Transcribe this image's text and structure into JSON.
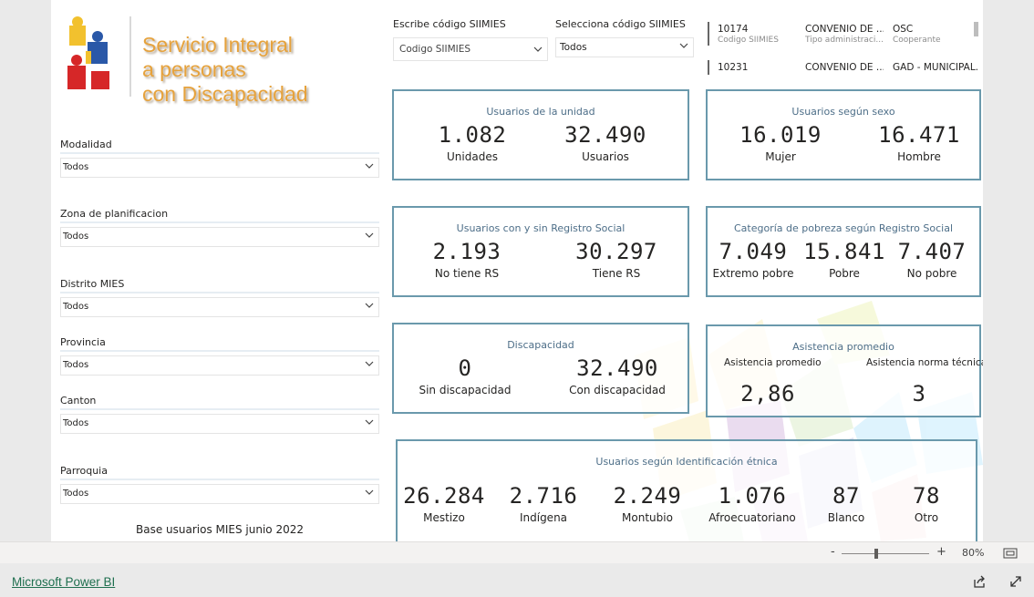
{
  "logo": {
    "lines": [
      "Servicio Integral",
      "a personas",
      "con Discapacidad"
    ]
  },
  "filters": {
    "modalidad": {
      "label": "Modalidad",
      "value": "Todos"
    },
    "zona": {
      "label": "Zona de planificacion",
      "value": "Todos"
    },
    "distrito": {
      "label": "Distrito MIES",
      "value": "Todos"
    },
    "provincia": {
      "label": "Provincia",
      "value": "Todos"
    },
    "canton": {
      "label": "Canton",
      "value": "Todos"
    },
    "parroquia": {
      "label": "Parroquia",
      "value": "Todos"
    }
  },
  "code_search": {
    "label": "Escribe código SIIMIES",
    "placeholder": "Codigo SIIMIES"
  },
  "code_select": {
    "label": "Selecciona código SIIMIES",
    "value": "Todos"
  },
  "table": {
    "rows": [
      {
        "code": "10174",
        "code_label": "Codigo SIIMIES",
        "admin": "CONVENIO DE ...",
        "admin_label": "Tipo administraci...",
        "coop": "OSC",
        "coop_label": "Cooperante"
      },
      {
        "code": "10231",
        "admin": "CONVENIO DE ...",
        "coop": "GAD - MUNICIPAL..."
      }
    ]
  },
  "cards": {
    "unidad": {
      "title": "Usuarios de la unidad",
      "metrics": [
        {
          "value": "1.082",
          "label": "Unidades"
        },
        {
          "value": "32.490",
          "label": "Usuarios"
        }
      ]
    },
    "sexo": {
      "title": "Usuarios según sexo",
      "metrics": [
        {
          "value": "16.019",
          "label": "Mujer"
        },
        {
          "value": "16.471",
          "label": "Hombre"
        }
      ]
    },
    "registro": {
      "title": "Usuarios con y sin Registro Social",
      "metrics": [
        {
          "value": "2.193",
          "label": "No tiene RS"
        },
        {
          "value": "30.297",
          "label": "Tiene RS"
        }
      ]
    },
    "pobreza": {
      "title": "Categoría de pobreza según Registro Social",
      "metrics": [
        {
          "value": "7.049",
          "label": "Extremo pobre"
        },
        {
          "value": "15.841",
          "label": "Pobre"
        },
        {
          "value": "7.407",
          "label": "No pobre"
        }
      ]
    },
    "discapacidad": {
      "title": "Discapacidad",
      "metrics": [
        {
          "value": "0",
          "label": "Sin discapacidad"
        },
        {
          "value": "32.490",
          "label": "Con discapacidad"
        }
      ]
    },
    "asistencia": {
      "title": "Asistencia promedio",
      "sub_left": "Asistencia promedio",
      "sub_right": "Asistencia norma técnica",
      "metrics": [
        {
          "value": "2,86"
        },
        {
          "value": "3"
        }
      ]
    },
    "etnia": {
      "title": "Usuarios según Identificación étnica",
      "metrics": [
        {
          "value": "26.284",
          "label": "Mestizo"
        },
        {
          "value": "2.716",
          "label": "Indígena"
        },
        {
          "value": "2.249",
          "label": "Montubio"
        },
        {
          "value": "1.076",
          "label": "Afroecuatoriano"
        },
        {
          "value": "87",
          "label": "Blanco"
        },
        {
          "value": "78",
          "label": "Otro"
        }
      ]
    }
  },
  "footnote": "Base usuarios MIES junio 2022",
  "status": {
    "zoom_minus": "-",
    "zoom_plus": "+",
    "zoom_pct": "80%",
    "zoom_level": 0.8
  },
  "footer": {
    "brand": "Microsoft Power BI"
  },
  "colors": {
    "card_border": "#6a99ac",
    "title_blue": "#4d6e88",
    "logo_orange": "#e6a23c",
    "brand_green": "#1f6f4f"
  }
}
